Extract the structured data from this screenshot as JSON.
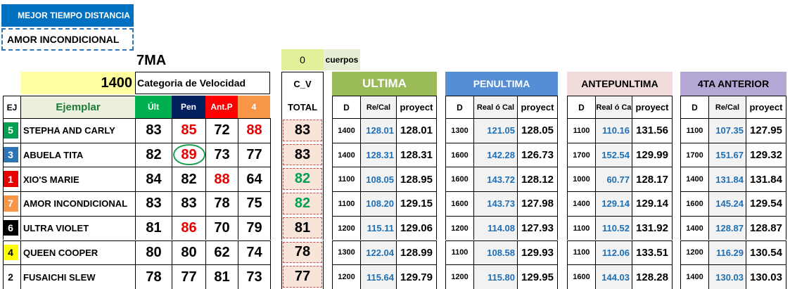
{
  "title": "MEJOR TIEMPO DISTANCIA",
  "best_horse": "AMOR INCONDICIONAL",
  "race": "7MA",
  "cv_value": "0",
  "cuerpos_label": "cuerpos",
  "distance": "1400",
  "speed_category": "Categoria de Velocidad",
  "headers": {
    "ej": "EJ",
    "ejemplar": "Ejemplar",
    "ult": "Últ",
    "pen": "Pen",
    "antp": "Ant.P",
    "four": "4",
    "cv": "C_V",
    "total": "TOTAL",
    "d": "D",
    "recal": "Re/Cal",
    "realocal": "Real ó Cal",
    "realocal_short": "Real ó Ca",
    "proyect": "proyect"
  },
  "sections": {
    "ultima": "ULTIMA",
    "penultima": "PENULTIMA",
    "antepenultima": "ANTEPUNLTIMA",
    "cuarta": "4TA ANTERIOR"
  },
  "colors": {
    "title_blue": "#0070c0",
    "green_hdr": "#00b050",
    "navy_hdr": "#002060",
    "red_hdr": "#ff0000",
    "orange_hdr": "#f79646",
    "ultima_bg": "#9bbb59",
    "penultima_bg": "#558ed5",
    "antep_bg": "#f2dcdb",
    "cuarta_bg": "#b4a7d6",
    "value_blue": "#1f6fb5",
    "red_text": "#e60000",
    "green_text": "#00a050"
  },
  "rows": [
    {
      "ej": "5",
      "ej_color": "#00a050",
      "name": "STEPHA AND CARLY",
      "ult": "83",
      "pen": "85",
      "antp": "72",
      "four": "88",
      "pen_red": true,
      "antp_red": false,
      "four_red": true,
      "total": "83",
      "total_green": false,
      "u": {
        "d": "1400",
        "rc": "128.01",
        "p": "128.01"
      },
      "pe": {
        "d": "1300",
        "rc": "121.05",
        "p": "128.05"
      },
      "an": {
        "d": "1100",
        "rc": "110.16",
        "p": "131.56"
      },
      "cu": {
        "d": "1100",
        "rc": "107.35",
        "p": "127.95"
      }
    },
    {
      "ej": "3",
      "ej_color": "#2e75b6",
      "name": "ABUELA TITA",
      "ult": "82",
      "pen": "89",
      "antp": "73",
      "four": "77",
      "pen_red": true,
      "antp_red": false,
      "four_red": false,
      "total": "83",
      "total_green": false,
      "u": {
        "d": "1400",
        "rc": "128.31",
        "p": "128.31"
      },
      "pe": {
        "d": "1600",
        "rc": "142.28",
        "p": "126.73"
      },
      "an": {
        "d": "1700",
        "rc": "152.54",
        "p": "129.99"
      },
      "cu": {
        "d": "1700",
        "rc": "151.67",
        "p": "129.32"
      }
    },
    {
      "ej": "1",
      "ej_color": "#e60000",
      "name": "XIO'S MARIE",
      "ult": "84",
      "pen": "82",
      "antp": "88",
      "four": "64",
      "pen_red": false,
      "antp_red": true,
      "four_red": false,
      "total": "82",
      "total_green": true,
      "u": {
        "d": "1100",
        "rc": "108.05",
        "p": "128.95"
      },
      "pe": {
        "d": "1600",
        "rc": "143.72",
        "p": "128.12"
      },
      "an": {
        "d": "1000",
        "rc": "60.77",
        "p": "128.17"
      },
      "cu": {
        "d": "1400",
        "rc": "131.84",
        "p": "131.84"
      }
    },
    {
      "ej": "7",
      "ej_color": "#f79646",
      "name": "AMOR INCONDICIONAL",
      "ult": "83",
      "pen": "83",
      "antp": "78",
      "four": "75",
      "pen_red": false,
      "antp_red": false,
      "four_red": false,
      "total": "82",
      "total_green": true,
      "u": {
        "d": "1100",
        "rc": "108.20",
        "p": "129.15"
      },
      "pe": {
        "d": "1600",
        "rc": "143.73",
        "p": "127.98"
      },
      "an": {
        "d": "1400",
        "rc": "129.14",
        "p": "129.14"
      },
      "cu": {
        "d": "1600",
        "rc": "145.24",
        "p": "129.54"
      }
    },
    {
      "ej": "6",
      "ej_color": "#000000",
      "name": "ULTRA VIOLET",
      "ult": "81",
      "pen": "86",
      "antp": "70",
      "four": "79",
      "pen_red": true,
      "antp_red": false,
      "four_red": false,
      "total": "81",
      "total_green": false,
      "u": {
        "d": "1200",
        "rc": "115.11",
        "p": "129.06"
      },
      "pe": {
        "d": "1200",
        "rc": "114.08",
        "p": "127.93"
      },
      "an": {
        "d": "1100",
        "rc": "110.52",
        "p": "131.92"
      },
      "cu": {
        "d": "1400",
        "rc": "128.87",
        "p": "128.87"
      }
    },
    {
      "ej": "4",
      "ej_color": "#ffff00",
      "name": "QUEEN COOPER",
      "ult": "80",
      "pen": "80",
      "antp": "62",
      "four": "74",
      "pen_red": false,
      "antp_red": false,
      "four_red": false,
      "total": "78",
      "total_green": false,
      "u": {
        "d": "1300",
        "rc": "122.04",
        "p": "128.99"
      },
      "pe": {
        "d": "1100",
        "rc": "108.58",
        "p": "129.93"
      },
      "an": {
        "d": "1100",
        "rc": "112.06",
        "p": "133.51"
      },
      "cu": {
        "d": "1200",
        "rc": "116.29",
        "p": "130.54"
      }
    },
    {
      "ej": "2",
      "ej_color": "#ffffff",
      "name": "FUSAICHI SLEW",
      "ult": "78",
      "pen": "77",
      "antp": "81",
      "four": "73",
      "pen_red": false,
      "antp_red": false,
      "four_red": false,
      "total": "77",
      "total_green": false,
      "u": {
        "d": "1200",
        "rc": "115.64",
        "p": "129.79"
      },
      "pe": {
        "d": "1200",
        "rc": "115.80",
        "p": "129.95"
      },
      "an": {
        "d": "1600",
        "rc": "144.03",
        "p": "128.28"
      },
      "cu": {
        "d": "1400",
        "rc": "130.03",
        "p": "130.03"
      }
    }
  ]
}
